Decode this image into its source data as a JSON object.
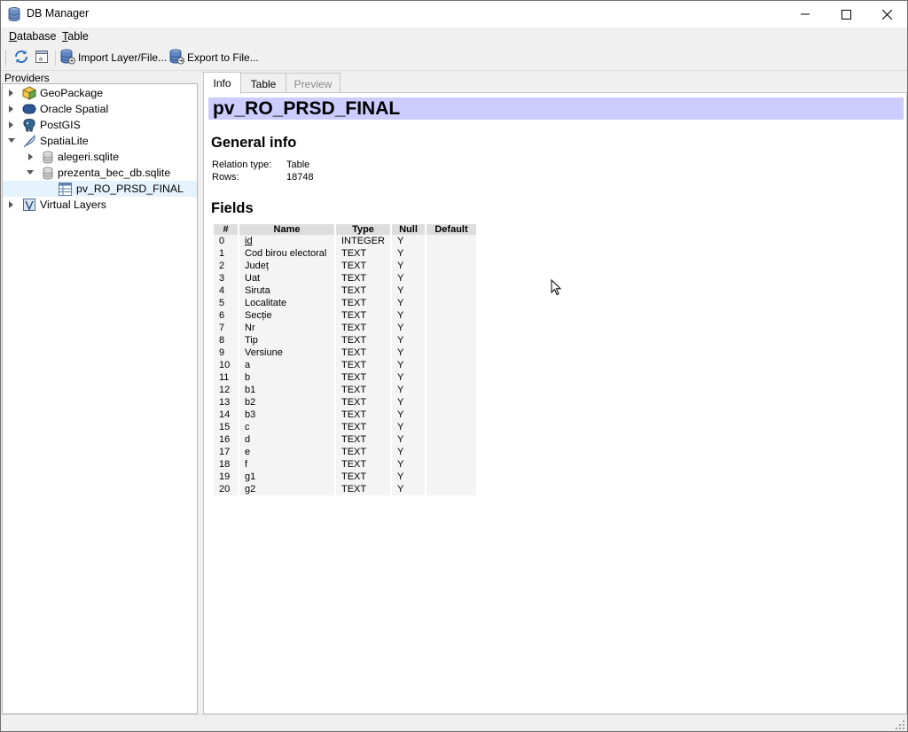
{
  "window": {
    "title": "DB Manager",
    "icon": "database-icon"
  },
  "menubar": {
    "items": [
      {
        "label": "Database"
      },
      {
        "label": "Table"
      }
    ]
  },
  "toolbar": {
    "refresh_icon": "refresh-icon",
    "sql_icon": "sql-window-icon",
    "import_label": "Import Layer/File...",
    "export_label": "Export to File..."
  },
  "providers": {
    "label": "Providers",
    "items": [
      {
        "label": "GeoPackage",
        "icon": "geopackage-icon",
        "expanded": false
      },
      {
        "label": "Oracle Spatial",
        "icon": "oracle-icon",
        "expanded": false
      },
      {
        "label": "PostGIS",
        "icon": "postgis-elephant-icon",
        "expanded": false
      },
      {
        "label": "SpatiaLite",
        "icon": "spatialite-feather-icon",
        "expanded": true
      },
      {
        "label": "alegeri.sqlite",
        "icon": "database-cylinder-icon",
        "expanded": false
      },
      {
        "label": "prezenta_bec_db.sqlite",
        "icon": "database-cylinder-icon",
        "expanded": true
      },
      {
        "label": "pv_RO_PRSD_FINAL",
        "icon": "table-icon",
        "selected": true
      },
      {
        "label": "Virtual Layers",
        "icon": "virtual-layers-icon",
        "expanded": false
      }
    ]
  },
  "tabs": [
    {
      "label": "Info",
      "active": true
    },
    {
      "label": "Table",
      "active": false
    },
    {
      "label": "Preview",
      "disabled": true
    }
  ],
  "info": {
    "table_name": "pv_RO_PRSD_FINAL",
    "general_heading": "General info",
    "relation_type_label": "Relation type:",
    "relation_type_value": "Table",
    "rows_label": "Rows:",
    "rows_value": "18748",
    "fields_heading": "Fields",
    "columns": [
      "#",
      "Name",
      "Type",
      "Null",
      "Default"
    ],
    "fields": [
      {
        "num": "0",
        "name": "id",
        "type": "INTEGER",
        "null": "Y",
        "default": ""
      },
      {
        "num": "1",
        "name": "Cod birou electoral",
        "type": "TEXT",
        "null": "Y",
        "default": ""
      },
      {
        "num": "2",
        "name": "Județ",
        "type": "TEXT",
        "null": "Y",
        "default": ""
      },
      {
        "num": "3",
        "name": "Uat",
        "type": "TEXT",
        "null": "Y",
        "default": ""
      },
      {
        "num": "4",
        "name": "Siruta",
        "type": "TEXT",
        "null": "Y",
        "default": ""
      },
      {
        "num": "5",
        "name": "Localitate",
        "type": "TEXT",
        "null": "Y",
        "default": ""
      },
      {
        "num": "6",
        "name": "Secție",
        "type": "TEXT",
        "null": "Y",
        "default": ""
      },
      {
        "num": "7",
        "name": "Nr",
        "type": "TEXT",
        "null": "Y",
        "default": ""
      },
      {
        "num": "8",
        "name": "Tip",
        "type": "TEXT",
        "null": "Y",
        "default": ""
      },
      {
        "num": "9",
        "name": "Versiune",
        "type": "TEXT",
        "null": "Y",
        "default": ""
      },
      {
        "num": "10",
        "name": "a",
        "type": "TEXT",
        "null": "Y",
        "default": ""
      },
      {
        "num": "11",
        "name": "b",
        "type": "TEXT",
        "null": "Y",
        "default": ""
      },
      {
        "num": "12",
        "name": "b1",
        "type": "TEXT",
        "null": "Y",
        "default": ""
      },
      {
        "num": "13",
        "name": "b2",
        "type": "TEXT",
        "null": "Y",
        "default": ""
      },
      {
        "num": "14",
        "name": "b3",
        "type": "TEXT",
        "null": "Y",
        "default": ""
      },
      {
        "num": "15",
        "name": "c",
        "type": "TEXT",
        "null": "Y",
        "default": ""
      },
      {
        "num": "16",
        "name": "d",
        "type": "TEXT",
        "null": "Y",
        "default": ""
      },
      {
        "num": "17",
        "name": "e",
        "type": "TEXT",
        "null": "Y",
        "default": ""
      },
      {
        "num": "18",
        "name": "f",
        "type": "TEXT",
        "null": "Y",
        "default": ""
      },
      {
        "num": "19",
        "name": "g1",
        "type": "TEXT",
        "null": "Y",
        "default": ""
      },
      {
        "num": "20",
        "name": "g2",
        "type": "TEXT",
        "null": "Y",
        "default": ""
      }
    ]
  },
  "colors": {
    "header_bar": "#ccccff",
    "selected_row": "#e5f3ff"
  }
}
